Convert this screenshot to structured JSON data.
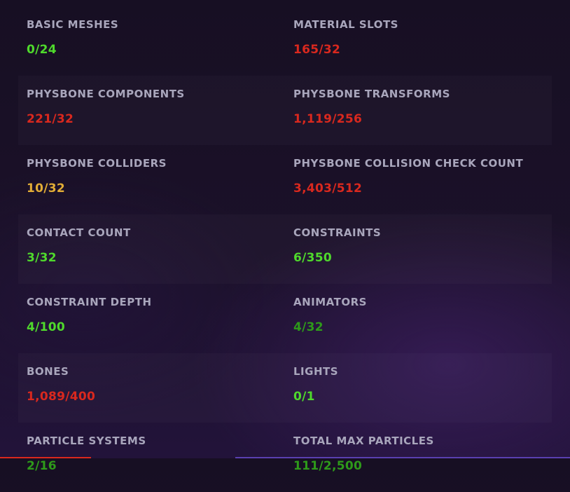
{
  "colors": {
    "good": "#4fd92c",
    "excellent": "#2e9a1a",
    "medium": "#e2ad36",
    "poor": "#d9281e",
    "label": "#a9a6bc"
  },
  "stats": [
    {
      "label": "BASIC MESHES",
      "value": "0/24",
      "status": "good"
    },
    {
      "label": "MATERIAL SLOTS",
      "value": "165/32",
      "status": "poor"
    },
    {
      "label": "PHYSBONE COMPONENTS",
      "value": "221/32",
      "status": "poor"
    },
    {
      "label": "PHYSBONE TRANSFORMS",
      "value": "1,119/256",
      "status": "poor"
    },
    {
      "label": "PHYSBONE COLLIDERS",
      "value": "10/32",
      "status": "medium"
    },
    {
      "label": "PHYSBONE COLLISION CHECK COUNT",
      "value": "3,403/512",
      "status": "poor"
    },
    {
      "label": "CONTACT COUNT",
      "value": "3/32",
      "status": "good"
    },
    {
      "label": "CONSTRAINTS",
      "value": "6/350",
      "status": "good"
    },
    {
      "label": "CONSTRAINT DEPTH",
      "value": "4/100",
      "status": "good"
    },
    {
      "label": "ANIMATORS",
      "value": "4/32",
      "status": "excellent"
    },
    {
      "label": "BONES",
      "value": "1,089/400",
      "status": "poor"
    },
    {
      "label": "LIGHTS",
      "value": "0/1",
      "status": "good"
    },
    {
      "label": "PARTICLE SYSTEMS",
      "value": "2/16",
      "status": "excellent"
    },
    {
      "label": "TOTAL MAX PARTICLES",
      "value": "111/2,500",
      "status": "excellent"
    }
  ]
}
